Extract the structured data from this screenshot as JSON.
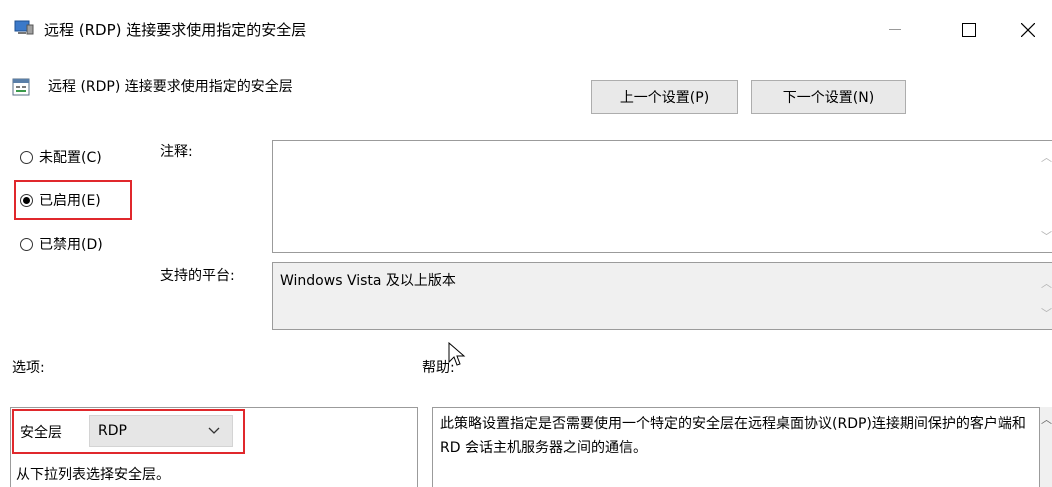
{
  "window": {
    "title": "远程 (RDP) 连接要求使用指定的安全层"
  },
  "header": {
    "policy_title": "远程 (RDP) 连接要求使用指定的安全层",
    "prev_label": "上一个设置(P)",
    "next_label": "下一个设置(N)"
  },
  "state": {
    "options": [
      {
        "label": "未配置(C)",
        "checked": false
      },
      {
        "label": "已启用(E)",
        "checked": true
      },
      {
        "label": "已禁用(D)",
        "checked": false
      }
    ]
  },
  "comment": {
    "label": "注释:",
    "value": ""
  },
  "platform": {
    "label": "支持的平台:",
    "value": "Windows Vista 及以上版本"
  },
  "options_section": {
    "label": "选项:",
    "security_label": "安全层",
    "security_value": "RDP",
    "description": "从下拉列表选择安全层。"
  },
  "help_section": {
    "label": "帮助:",
    "text": "此策略设置指定是否需要使用一个特定的安全层在远程桌面协议(RDP)连接期间保护的客户端和 RD 会话主机服务器之间的通信。"
  },
  "colors": {
    "highlight": "#e0282c"
  }
}
